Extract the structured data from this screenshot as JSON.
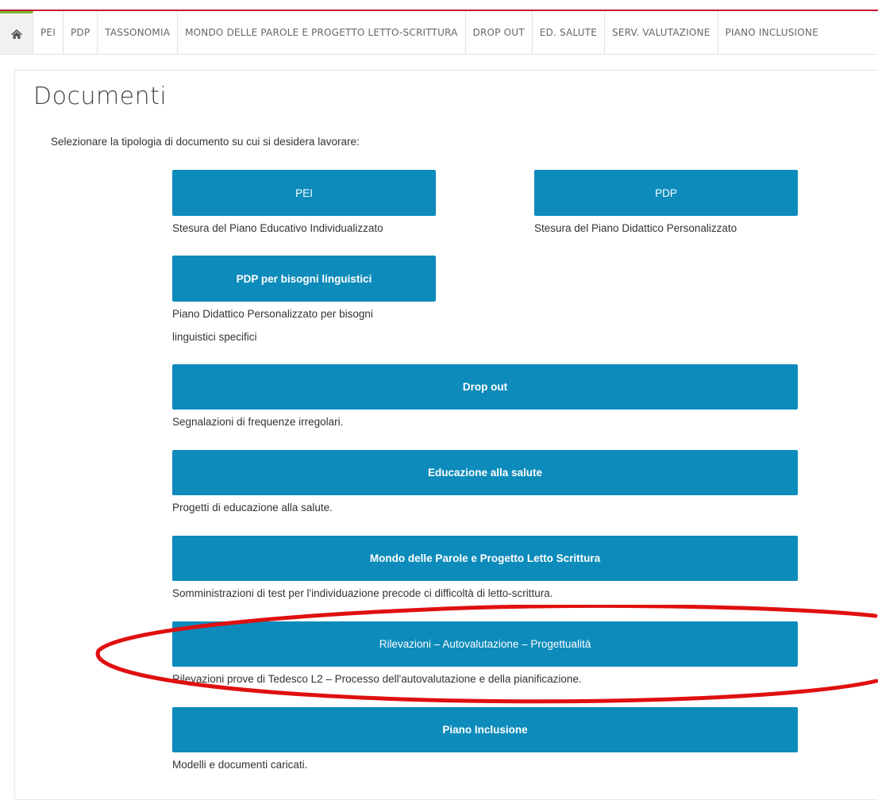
{
  "nav": {
    "items": [
      "PEI",
      "PDP",
      "TASSONOMIA",
      "MONDO DELLE PAROLE E PROGETTO LETTO-SCRITTURA",
      "DROP OUT",
      "ED. SALUTE",
      "SERV. VALUTAZIONE",
      "PIANO INCLUSIONE"
    ],
    "accent_color": "#79b93b",
    "top_line_color": "#c8102e"
  },
  "page": {
    "title": "Documenti",
    "intro": "Selezionare la tipologia di documento su cui si desidera lavorare:"
  },
  "documents": [
    {
      "label": "PEI",
      "description": "Stesura del Piano Educativo Individualizzato"
    },
    {
      "label": "PDP",
      "description": "Stesura del Piano Didattico Personalizzato"
    },
    {
      "label": "PDP per bisogni linguistici",
      "description_line1": "Piano Didattico Personalizzato per bisogni",
      "description_line2": "linguistici specifici"
    },
    {
      "label": "Drop out",
      "description": "Segnalazioni di frequenze irregolari."
    },
    {
      "label": "Educazione alla salute",
      "description": "Progetti di educazione alla salute."
    },
    {
      "label": "Mondo delle Parole e Progetto Letto Scrittura",
      "description": "Somministrazioni di test per l'individuazione precode ci difficoltà di letto-scrittura."
    },
    {
      "label": "Rilevazioni – Autovalutazione – Progettualità",
      "description": "Rilevazioni prove di Tedesco L2 – Processo dell'autovalutazione e della pianificazione."
    },
    {
      "label": "Piano Inclusione",
      "description": "Modelli e documenti caricati."
    }
  ],
  "colors": {
    "button": "#0d8bbb",
    "highlight": "#e01010"
  },
  "icons": {
    "home": "home-icon"
  }
}
